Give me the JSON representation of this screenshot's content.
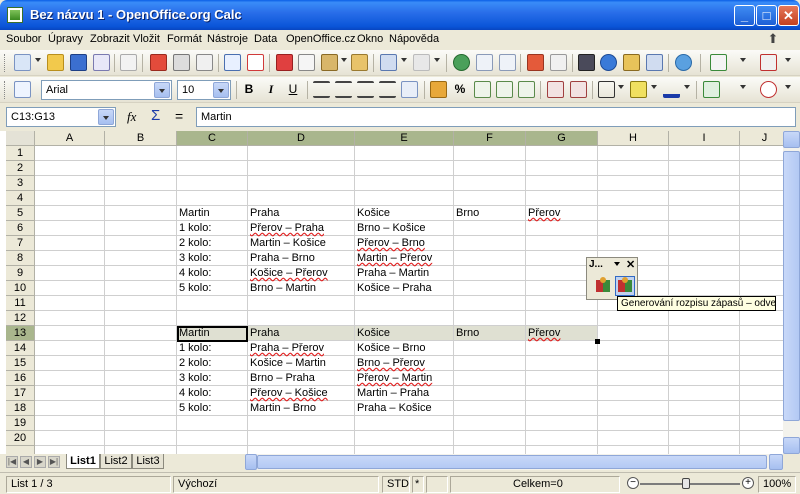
{
  "window": {
    "title": "Bez názvu 1 - OpenOffice.org Calc",
    "min": "_",
    "max": "□",
    "close": "✕"
  },
  "menu": [
    "Soubor",
    "Úpravy",
    "Zobrazit",
    "Vložit",
    "Formát",
    "Nástroje",
    "Data",
    "OpenOffice.cz",
    "Okno",
    "Nápověda"
  ],
  "format_toolbar": {
    "font_name": "Arial",
    "font_size": "10",
    "bold": "B",
    "italic": "I",
    "underline": "U",
    "percent": "%"
  },
  "name_box": "C13:G13",
  "formula_symbols": {
    "fx": "fx",
    "sum": "Σ",
    "equals": "="
  },
  "formula_value": "Martin",
  "columns": [
    "A",
    "B",
    "C",
    "D",
    "E",
    "F",
    "G",
    "H",
    "I",
    "J"
  ],
  "rows": [
    "1",
    "2",
    "3",
    "4",
    "5",
    "6",
    "7",
    "8",
    "9",
    "10",
    "11",
    "12",
    "13",
    "14",
    "15",
    "16",
    "17",
    "18",
    "19",
    "20"
  ],
  "cells": [
    {
      "row": 5,
      "col": "C",
      "text": "Martin"
    },
    {
      "row": 5,
      "col": "D",
      "text": "Praha"
    },
    {
      "row": 5,
      "col": "E",
      "text": "Košice"
    },
    {
      "row": 5,
      "col": "F",
      "text": "Brno"
    },
    {
      "row": 5,
      "col": "G",
      "text": "Přerov",
      "spell": true
    },
    {
      "row": 6,
      "col": "C",
      "text": " 1 kolo:"
    },
    {
      "row": 6,
      "col": "D",
      "text": "Přerov – Praha",
      "spell": true
    },
    {
      "row": 6,
      "col": "E",
      "text": "Brno – Košice"
    },
    {
      "row": 7,
      "col": "C",
      "text": " 2 kolo:"
    },
    {
      "row": 7,
      "col": "D",
      "text": "Martin – Košice"
    },
    {
      "row": 7,
      "col": "E",
      "text": "Přerov – Brno",
      "spell": true
    },
    {
      "row": 8,
      "col": "C",
      "text": " 3 kolo:"
    },
    {
      "row": 8,
      "col": "D",
      "text": "Praha – Brno"
    },
    {
      "row": 8,
      "col": "E",
      "text": "Martin – Přerov",
      "spell": true
    },
    {
      "row": 9,
      "col": "C",
      "text": " 4 kolo:"
    },
    {
      "row": 9,
      "col": "D",
      "text": "Košice – Přerov",
      "spell": true
    },
    {
      "row": 9,
      "col": "E",
      "text": "Praha – Martin"
    },
    {
      "row": 10,
      "col": "C",
      "text": " 5 kolo:"
    },
    {
      "row": 10,
      "col": "D",
      "text": "Brno – Martin"
    },
    {
      "row": 10,
      "col": "E",
      "text": "Košice – Praha"
    },
    {
      "row": 13,
      "col": "C",
      "text": "Martin"
    },
    {
      "row": 13,
      "col": "D",
      "text": "Praha"
    },
    {
      "row": 13,
      "col": "E",
      "text": "Košice"
    },
    {
      "row": 13,
      "col": "F",
      "text": "Brno"
    },
    {
      "row": 13,
      "col": "G",
      "text": "Přerov",
      "spell": true
    },
    {
      "row": 14,
      "col": "C",
      "text": " 1 kolo:"
    },
    {
      "row": 14,
      "col": "D",
      "text": "Praha – Přerov",
      "spell": true
    },
    {
      "row": 14,
      "col": "E",
      "text": "Košice – Brno"
    },
    {
      "row": 15,
      "col": "C",
      "text": " 2 kolo:"
    },
    {
      "row": 15,
      "col": "D",
      "text": "Košice – Martin"
    },
    {
      "row": 15,
      "col": "E",
      "text": "Brno – Přerov",
      "spell": true
    },
    {
      "row": 16,
      "col": "C",
      "text": " 3 kolo:"
    },
    {
      "row": 16,
      "col": "D",
      "text": "Brno – Praha"
    },
    {
      "row": 16,
      "col": "E",
      "text": "Přerov – Martin",
      "spell": true
    },
    {
      "row": 17,
      "col": "C",
      "text": " 4 kolo:"
    },
    {
      "row": 17,
      "col": "D",
      "text": "Přerov – Košice",
      "spell": true
    },
    {
      "row": 17,
      "col": "E",
      "text": "Martin – Praha"
    },
    {
      "row": 18,
      "col": "C",
      "text": " 5 kolo:"
    },
    {
      "row": 18,
      "col": "D",
      "text": "Martin – Brno"
    },
    {
      "row": 18,
      "col": "E",
      "text": "Praha – Košice"
    }
  ],
  "floating_toolbar": {
    "title": "J...",
    "tooltip": "Generování rozpisu zápasů – odveta"
  },
  "sheet_tabs": [
    "List1",
    "List2",
    "List3"
  ],
  "active_sheet": "List1",
  "status": {
    "sheet": "List 1 / 3",
    "style": "Výchozí",
    "mode": "STD",
    "modified": "*",
    "sum": "Celkem=0",
    "zoom": "100%"
  },
  "colors": {
    "title_bar": "#0a55d8",
    "selection_header": "#a9b68d",
    "selection_band": "#dfe0d2",
    "tooltip_bg": "#ffffe1"
  }
}
